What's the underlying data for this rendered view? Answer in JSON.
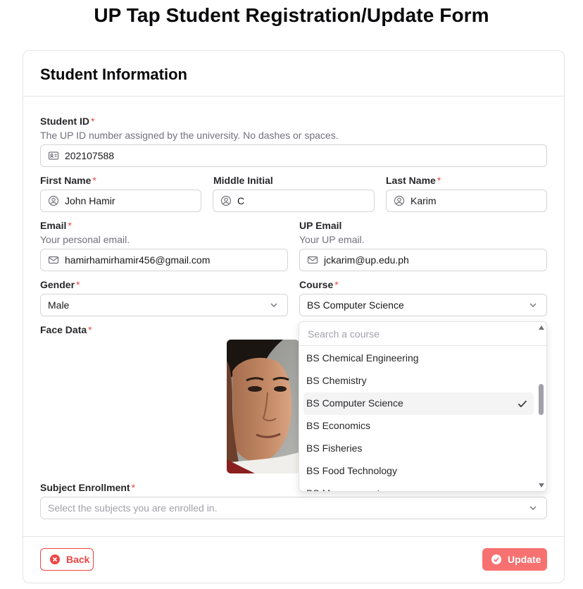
{
  "page": {
    "title": "UP Tap Student Registration/Update Form"
  },
  "card": {
    "title": "Student Information"
  },
  "required_marker": "*",
  "student_id": {
    "label": "Student ID",
    "description": "The UP ID number assigned by the university. No dashes or spaces.",
    "value": "202107588",
    "icon": "id-card-icon"
  },
  "first_name": {
    "label": "First Name",
    "value": "John Hamir",
    "icon": "user-circle-icon"
  },
  "middle_initial": {
    "label": "Middle Initial",
    "value": "C",
    "icon": "user-circle-icon"
  },
  "last_name": {
    "label": "Last Name",
    "value": "Karim",
    "icon": "user-circle-icon"
  },
  "email": {
    "label": "Email",
    "description": "Your personal email.",
    "value": "hamirhamirhamir456@gmail.com",
    "icon": "mail-icon"
  },
  "up_email": {
    "label": "UP Email",
    "description": "Your UP email.",
    "value": "jckarim@up.edu.ph",
    "icon": "mail-icon"
  },
  "gender": {
    "label": "Gender",
    "value": "Male"
  },
  "course": {
    "label": "Course",
    "value": "BS Computer Science",
    "search_placeholder": "Search a course",
    "options": [
      "BS Chemical Engineering",
      "BS Chemistry",
      "BS Computer Science",
      "BS Economics",
      "BS Fisheries",
      "BS Food Technology",
      "BS Management"
    ],
    "selected_index": 2
  },
  "face_data": {
    "label": "Face Data"
  },
  "subject_enrollment": {
    "label": "Subject Enrollment",
    "placeholder": "Select the subjects you are enrolled in."
  },
  "buttons": {
    "back": "Back",
    "update": "Update"
  },
  "colors": {
    "accent_red": "#ef4444",
    "update_bg": "#f87171",
    "border": "#d4d4d8"
  }
}
